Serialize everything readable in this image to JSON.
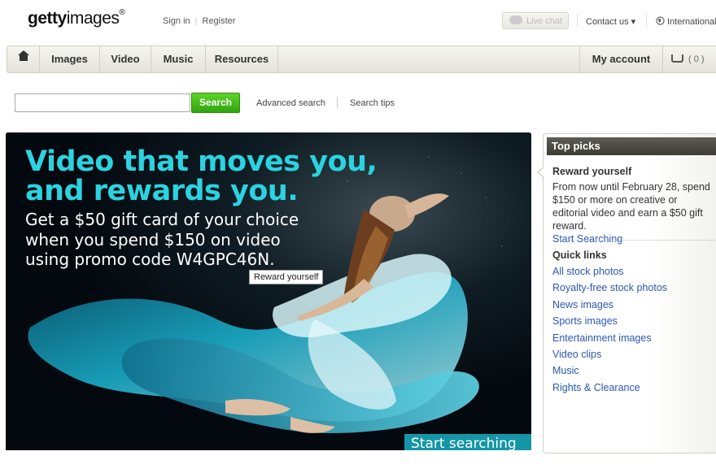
{
  "header": {
    "logo_bold": "getty",
    "logo_rest": "images",
    "logo_mark": "®",
    "sign_in": "Sign in",
    "register": "Register",
    "live_chat": "Live chat",
    "contact_us": "Contact us ▾",
    "international": "International"
  },
  "nav": {
    "home_icon": "home-icon",
    "items": [
      "Images",
      "Video",
      "Music",
      "Resources"
    ],
    "my_account": "My account",
    "cart_count": "( 0 )"
  },
  "search": {
    "placeholder": "",
    "button": "Search",
    "advanced": "Advanced search",
    "tips": "Search tips"
  },
  "hero": {
    "headline_1": "Video that moves you,",
    "headline_2": "and rewards you.",
    "body_1": "Get a $50 gift card of your choice",
    "body_2": "when you spend $150 on video",
    "body_3": "using promo code W4GPC46N.",
    "tooltip": "Reward yourself",
    "cta": "Start searching >"
  },
  "sidebar": {
    "title": "Top picks",
    "promo_title": "Reward yourself",
    "promo_body": "From now until February 28, spend $150 or more on creative or editorial video and earn a $50 gift reward.",
    "promo_link": "Start Searching",
    "quick_links_title": "Quick links",
    "quick_links": [
      "All stock photos",
      "Royalty-free stock photos",
      "News images",
      "Sports images",
      "Entertainment images",
      "Video clips",
      "Music",
      "Rights & Clearance"
    ]
  },
  "colors": {
    "accent_cyan": "#2bd3e0",
    "search_green": "#3bb516",
    "link_blue": "#2a58b6",
    "cta_teal": "#1596a6"
  }
}
